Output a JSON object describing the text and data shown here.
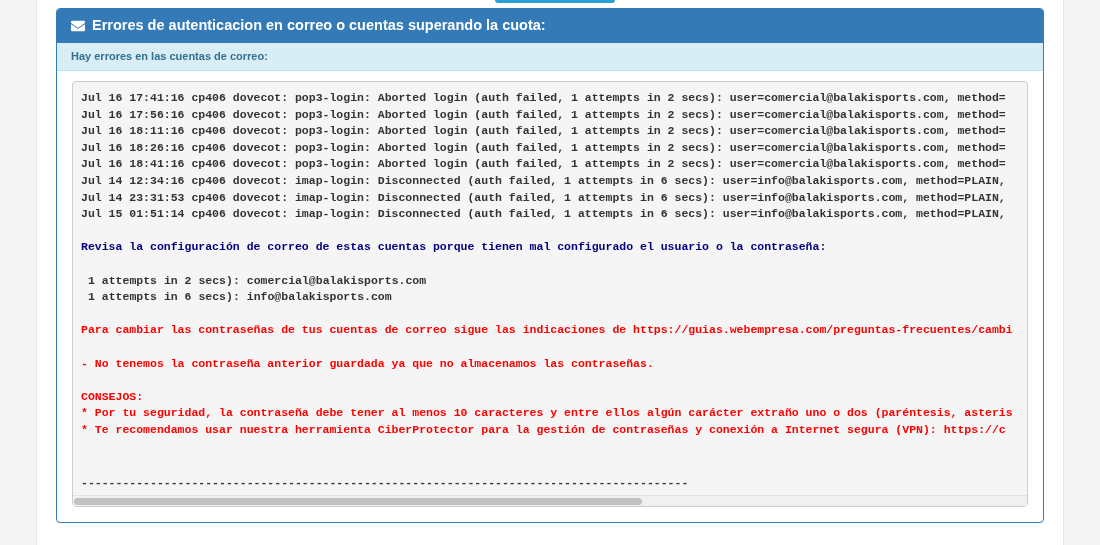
{
  "panel": {
    "title": "Errores de autenticacion en correo o cuentas superando la cuota:",
    "subtitle": "Hay errores en las cuentas de correo:"
  },
  "log_blocks": [
    {
      "kind": "log",
      "lines": [
        "Jul 16 17:41:16 cp406 dovecot: pop3-login: Aborted login (auth failed, 1 attempts in 2 secs): user=comercial@balakisports.com, method=",
        "Jul 16 17:56:16 cp406 dovecot: pop3-login: Aborted login (auth failed, 1 attempts in 2 secs): user=comercial@balakisports.com, method=",
        "Jul 16 18:11:16 cp406 dovecot: pop3-login: Aborted login (auth failed, 1 attempts in 2 secs): user=comercial@balakisports.com, method=",
        "Jul 16 18:26:16 cp406 dovecot: pop3-login: Aborted login (auth failed, 1 attempts in 2 secs): user=comercial@balakisports.com, method=",
        "Jul 16 18:41:16 cp406 dovecot: pop3-login: Aborted login (auth failed, 1 attempts in 2 secs): user=comercial@balakisports.com, method=",
        "Jul 14 12:34:16 cp406 dovecot: imap-login: Disconnected (auth failed, 1 attempts in 6 secs): user=info@balakisports.com, method=PLAIN,",
        "Jul 14 23:31:53 cp406 dovecot: imap-login: Disconnected (auth failed, 1 attempts in 6 secs): user=info@balakisports.com, method=PLAIN,",
        "Jul 15 01:51:14 cp406 dovecot: imap-login: Disconnected (auth failed, 1 attempts in 6 secs): user=info@balakisports.com, method=PLAIN,"
      ]
    },
    {
      "kind": "notice",
      "lines": [
        "Revisa la configuración de correo de estas cuentas porque tienen mal configurado el usuario o la contraseña:"
      ]
    },
    {
      "kind": "account",
      "lines": [
        "1 attempts in 2 secs): comercial@balakisports.com",
        "1 attempts in 6 secs): info@balakisports.com"
      ]
    },
    {
      "kind": "warning",
      "lines": [
        "Para cambiar las contraseñas de tus cuentas de correo sigue las indicaciones de https://guias.webempresa.com/preguntas-frecuentes/cambi"
      ]
    },
    {
      "kind": "warning",
      "lines": [
        "- No tenemos la contraseña anterior guardada ya que no almacenamos las contraseñas."
      ]
    },
    {
      "kind": "warning",
      "lines": [
        "CONSEJOS:",
        "* Por tu seguridad, la contraseña debe tener al menos 10 caracteres y entre ellos algún carácter extraño uno o dos (paréntesis, asteris",
        "* Te recomendamos usar nuestra herramienta CiberProtector para la gestión de contraseñas y conexión a Internet segura (VPN): https://c"
      ]
    },
    {
      "kind": "separator",
      "lines": [
        "----------------------------------------------------------------------------------------"
      ]
    }
  ]
}
